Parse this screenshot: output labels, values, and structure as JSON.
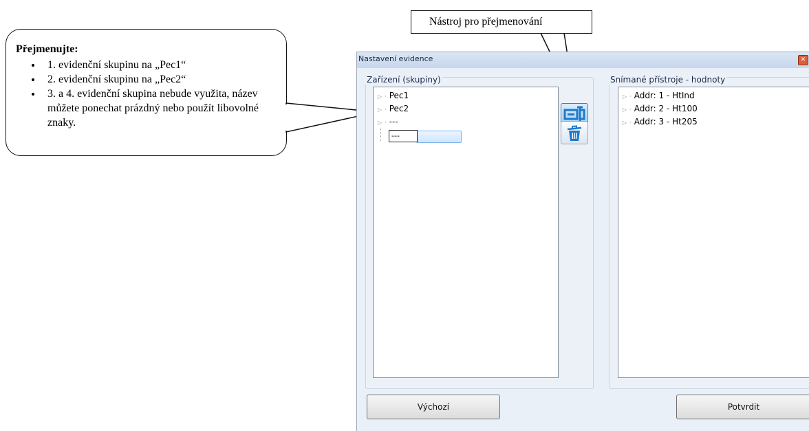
{
  "callout_instructions": {
    "title": "Přejmenujte:",
    "items": [
      "1.  evidenční skupinu na „Pec1“",
      "2.  evidenční skupinu na „Pec2“",
      "3. a 4. evidenční skupina nebude využita, název můžete ponechat prázdný nebo použít libovolné znaky."
    ]
  },
  "callout_tool": {
    "text": "Nástroj pro přejmenování"
  },
  "dialog": {
    "title": "Nastavení evidence",
    "close_glyph": "✕",
    "left_group": {
      "label": "Zařízení (skupiny)",
      "items": [
        "Pec1",
        "Pec2",
        "---"
      ],
      "edit_value": "---"
    },
    "right_group": {
      "label": "Snímané přístroje - hodnoty",
      "items": [
        "Addr: 1 - HtInd",
        "Addr: 2 - Ht100",
        "Addr: 3 - Ht205"
      ]
    },
    "tools": {
      "rename_icon": "rename-icon",
      "delete_icon": "trash-icon"
    },
    "buttons": {
      "default_label": "Výchozí",
      "confirm_label": "Potvrdit"
    }
  },
  "colors": {
    "dialog_bg": "#eaf0f8",
    "icon_blue": "#1f79c7",
    "selection": "#cfe6ff"
  }
}
